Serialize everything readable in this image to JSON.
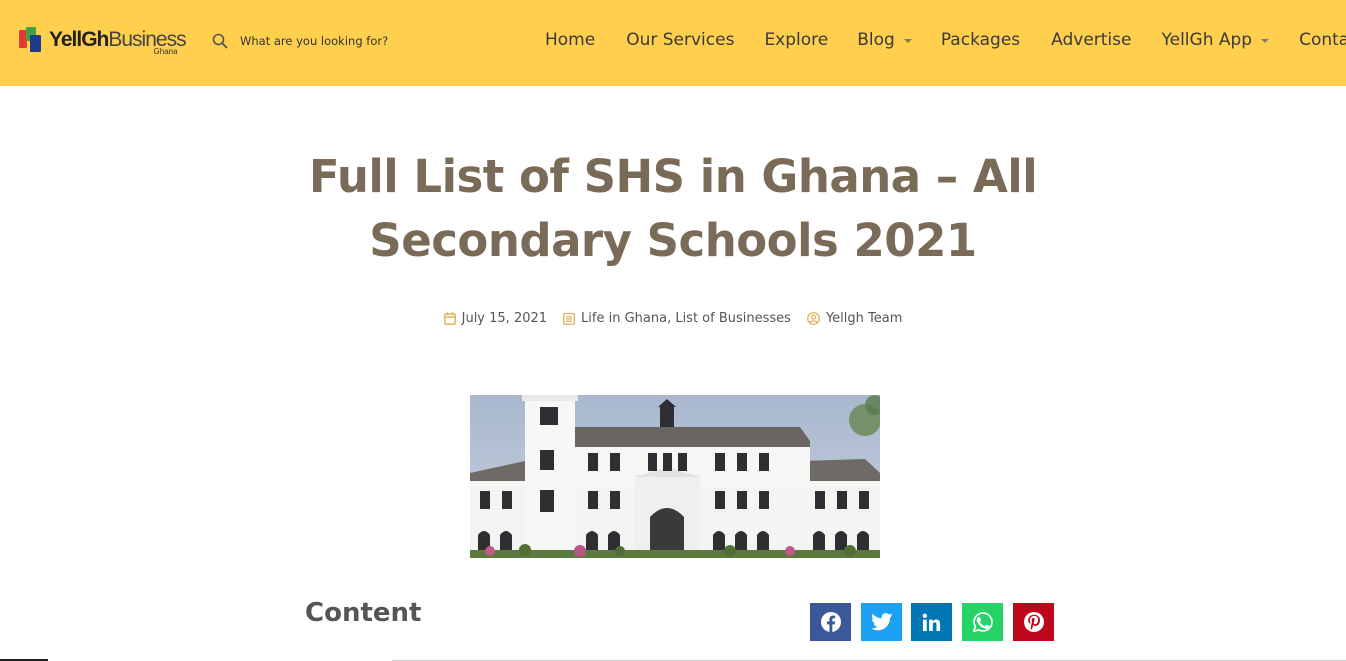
{
  "logo": {
    "part1": "YellGh",
    "part2": "Business",
    "sub": "Ghana"
  },
  "search": {
    "placeholder": "What are you looking for?"
  },
  "nav": {
    "home": "Home",
    "services": "Our Services",
    "explore": "Explore",
    "blog": "Blog",
    "packages": "Packages",
    "advertise": "Advertise",
    "app": "YellGh App",
    "contact": "Contac"
  },
  "article": {
    "title_line1": "Full List of SHS in Ghana – All",
    "title_line2": "Secondary Schools 2021",
    "date": "July 15, 2021",
    "category1": "Life in Ghana",
    "category_sep": ", ",
    "category2": "List of Businesses",
    "author": "Yellgh Team"
  },
  "content": {
    "heading": "Content"
  },
  "share": {
    "facebook_color": "#3b5998",
    "twitter_color": "#1da1f2",
    "linkedin_color": "#0077b5",
    "whatsapp_color": "#25d366",
    "pinterest_color": "#bd081c"
  },
  "colors": {
    "header_bg": "#ffcf4d",
    "title": "#7a6b59",
    "meta_icon": "#e0a94a"
  }
}
